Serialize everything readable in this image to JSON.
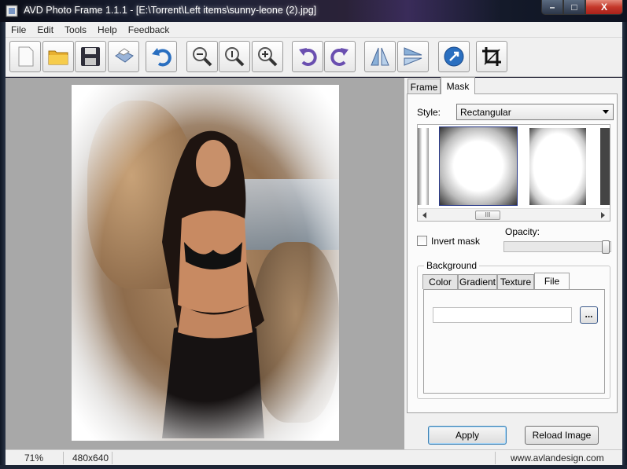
{
  "window": {
    "title": "AVD Photo Frame 1.1.1 - [E:\\Torrent\\Left items\\sunny-leone (2).jpg]",
    "min_label": "–",
    "max_label": "□",
    "close_label": "X"
  },
  "menu": [
    "File",
    "Edit",
    "Tools",
    "Help",
    "Feedback"
  ],
  "toolbar": {
    "buttons": [
      "new-icon",
      "open-folder-icon",
      "save-icon",
      "print-icon",
      "undo-icon",
      "zoom-out-icon",
      "zoom-actual-icon",
      "zoom-in-icon",
      "rotate-left-icon",
      "rotate-right-icon",
      "flip-horizontal-icon",
      "flip-vertical-icon",
      "web-icon",
      "crop-icon"
    ]
  },
  "panel": {
    "tabs": [
      "Frame",
      "Mask"
    ],
    "active_tab": "Mask",
    "style_label": "Style:",
    "style_value": "Rectangular",
    "scroll_thumb": "III",
    "invert_mask_label": "Invert mask",
    "opacity_label": "Opacity:",
    "opacity_value": 1.0,
    "background_label": "Background",
    "bg_tabs": [
      "Color",
      "Gradient",
      "Texture",
      "File"
    ],
    "active_bg_tab": "File",
    "file_value": "",
    "browse_label": "...",
    "apply_label": "Apply",
    "reload_label": "Reload Image"
  },
  "status": {
    "zoom": "71%",
    "dimensions": "480x640",
    "website": "www.avlandesign.com"
  },
  "colors": {
    "accent": "#3c7fb1",
    "toolbar_purple": "#6a4fb0",
    "toolbar_blue": "#2a6fc0"
  }
}
